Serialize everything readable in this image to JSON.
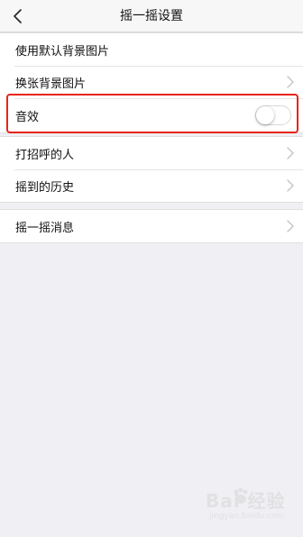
{
  "header": {
    "title": "摇一摇设置",
    "back_icon": "chevron-left-icon"
  },
  "group1": {
    "items": [
      {
        "label": "使用默认背景图片",
        "has_chevron": false
      },
      {
        "label": "换张背景图片",
        "has_chevron": true
      },
      {
        "label": "音效",
        "toggle": "off",
        "highlighted": true
      }
    ]
  },
  "group2": {
    "items": [
      {
        "label": "打招呼的人",
        "has_chevron": true
      },
      {
        "label": "摇到的历史",
        "has_chevron": true
      }
    ]
  },
  "group3": {
    "items": [
      {
        "label": "摇一摇消息",
        "has_chevron": true
      }
    ]
  },
  "watermark": {
    "text": "Bai 经验",
    "sub": "jingyan.baidu.com"
  },
  "colors": {
    "background": "#efeff4",
    "highlight": "#e8241a",
    "chevron": "#c7c7cc"
  }
}
